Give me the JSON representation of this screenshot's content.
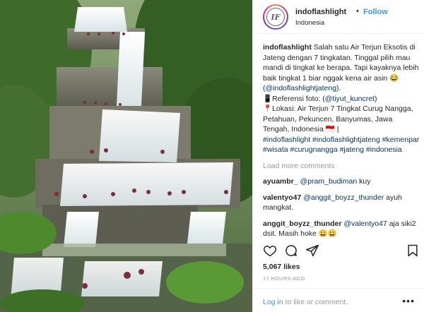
{
  "post": {
    "username": "indoflashlight",
    "separator": "•",
    "follow_label": "Follow",
    "location": "Indonesia",
    "avatar_text": "IF"
  },
  "caption": {
    "username": "indoflashlight",
    "line1": "Salah satu Air Terjun Eksotis di Jateng dengan 7 tingkatan. Tinggal pilih mau mandi di tingkat ke berapa. Tapi kayaknya lebih baik tingkat 1 biar nggak kena air asin 😂",
    "line2": "(@indoflashlightjateng).",
    "line3_label": "📱Referensi foto: ",
    "line3_link": "(@tiyut_kuncret)",
    "line4": "📍Lokasi: Air Terjun 7 Tingkat Curug Nangga, Petahuan, Pekuncen, Banyumas, Jawa Tengah, Indonesia 🇮🇩 |",
    "hashtags": "#indoflashlight #indoflashlightjateng #kemenpar #wisata #curugnangga #jateng #indonesia"
  },
  "load_more_label": "Load more comments",
  "comments": [
    {
      "user": "ayuambr_",
      "mention": "@pram_budiman",
      "text": " kuy"
    },
    {
      "user": "valentyo47",
      "mention": "@anggit_boyzz_thunder",
      "text": " ayuh mangkat."
    },
    {
      "user": "anggit_boyzz_thunder",
      "mention": "@valentyo47",
      "text": " aja siki2 dsit. Masih hoke 😀😀"
    }
  ],
  "likes": "5,067 likes",
  "timestamp": "17 HOURS AGO",
  "footer": {
    "login_label": "Log in",
    "suffix": " to like or comment.",
    "more_label": "•••"
  },
  "icons": {
    "like": "heart-icon",
    "comment": "comment-icon",
    "share": "share-icon",
    "save": "bookmark-icon"
  }
}
